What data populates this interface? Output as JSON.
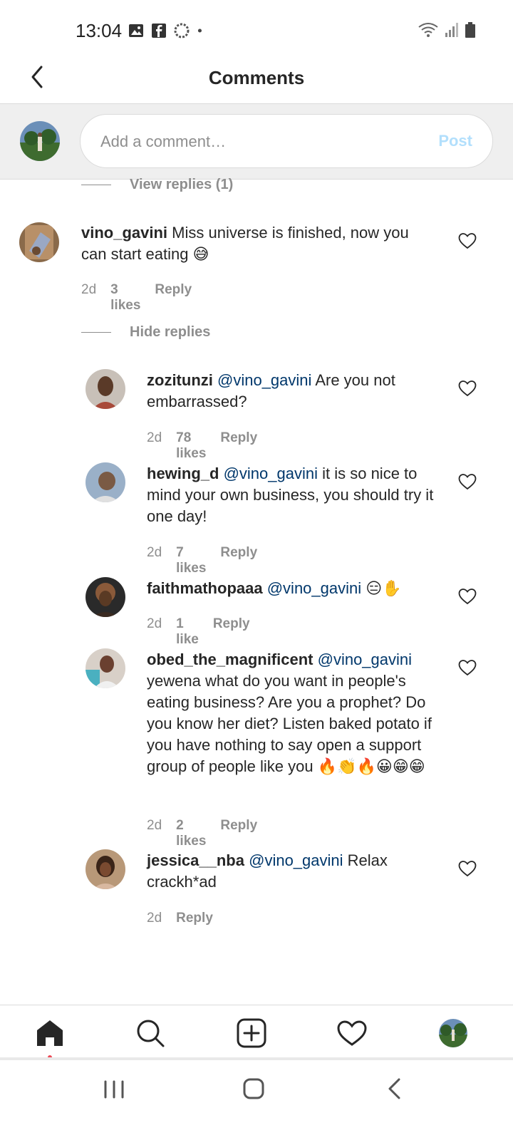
{
  "status_bar": {
    "time": "13:04",
    "left_icons": [
      "image-icon",
      "facebook-icon",
      "sync-icon",
      "dot-icon"
    ],
    "right_icons": [
      "wifi-icon",
      "signal-icon",
      "battery-icon"
    ]
  },
  "header": {
    "title": "Comments",
    "back_icon": "chevron-left-icon"
  },
  "comment_input": {
    "placeholder": "Add a comment…",
    "post_label": "Post"
  },
  "thread_top": {
    "view_replies": "View replies (1)"
  },
  "main_comment": {
    "username": "vino_gavini",
    "text": " Miss universe is finished, now you can start eating 😅",
    "time": "2d",
    "likes": "3 likes",
    "reply": "Reply",
    "hide_replies": "Hide replies"
  },
  "replies": [
    {
      "username": "zozitunzi",
      "mention": "@vino_gavini",
      "text": " Are you not embarrassed?",
      "time": "2d",
      "likes": "78 likes",
      "reply": "Reply"
    },
    {
      "username": "hewing_d",
      "mention": "@vino_gavini",
      "text": " it is so nice to mind your own business, you should try it one day!",
      "time": "2d",
      "likes": "7 likes",
      "reply": "Reply"
    },
    {
      "username": "faithmathopaaa",
      "mention": "@vino_gavini",
      "text": " 😑✋",
      "time": "2d",
      "likes": "1 like",
      "reply": "Reply"
    },
    {
      "username": "obed_the_magnificent",
      "mention": "@vino_gavini",
      "text": " yewena what do you want in people's eating business? Are you a prophet? Do you know her diet? Listen baked potato if you have nothing to say open a support group of people like you 🔥👏🔥😀😁😁",
      "time": "2d",
      "likes": "2 likes",
      "reply": "Reply"
    },
    {
      "username": "jessica__nba",
      "mention": "@vino_gavini",
      "text": " Relax crackh*ad",
      "time": "2d",
      "likes": "",
      "reply": "Reply"
    }
  ],
  "bottom_nav": {
    "items": [
      "home-icon",
      "search-icon",
      "add-post-icon",
      "activity-heart-icon",
      "profile-avatar"
    ]
  },
  "system_nav": {
    "items": [
      "recent-apps-icon",
      "home-button-icon",
      "back-icon"
    ]
  },
  "colors": {
    "mention": "#00376b",
    "muted": "#8e8e8e",
    "post_disabled": "#b2dffc",
    "notification_dot": "#ed4956"
  }
}
